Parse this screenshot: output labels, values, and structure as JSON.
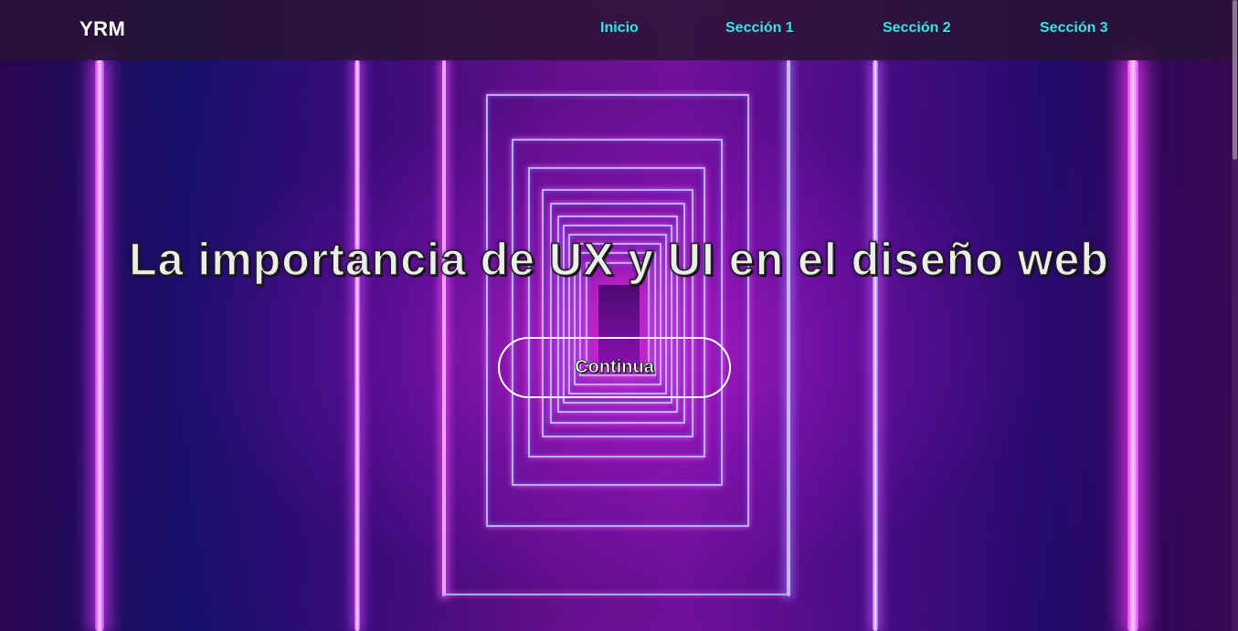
{
  "header": {
    "logo": "YRM",
    "nav": [
      {
        "label": "Inicio"
      },
      {
        "label": "Sección 1"
      },
      {
        "label": "Sección 2"
      },
      {
        "label": "Sección 3"
      }
    ]
  },
  "hero": {
    "title": "La importancia de UX y UI en el diseño web",
    "cta_label": "Continua"
  },
  "colors": {
    "nav_link": "#35e5e0",
    "header_bg": "#28142f",
    "text": "#ececec"
  }
}
